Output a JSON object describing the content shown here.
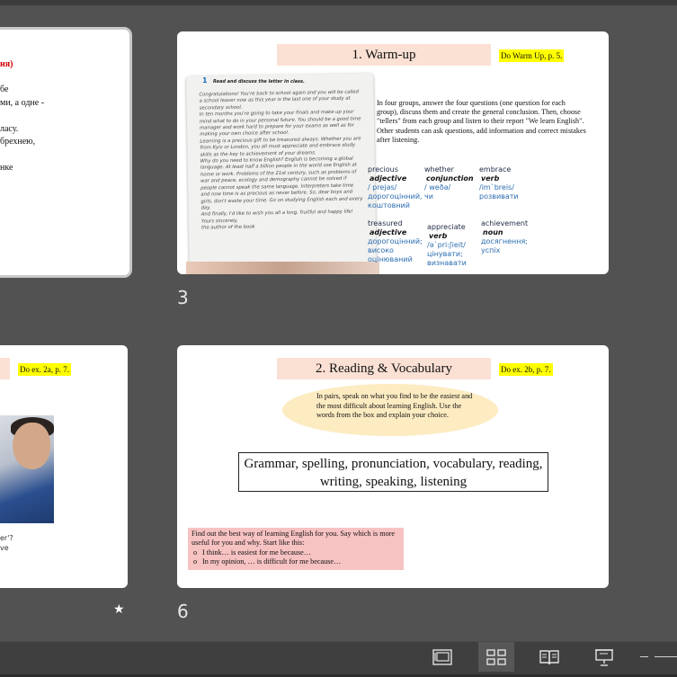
{
  "slides": [
    {
      "number": "",
      "red_heading": "ня)",
      "lines": [
        "бе",
        "ми, а одне -",
        "",
        "ласу.",
        "брехнею,",
        "",
        "нке"
      ]
    },
    {
      "number": "3",
      "title": "1. Warm-up",
      "note": "Do Warm Up, p. 5.",
      "exercise_num": "1",
      "exercise_head": "Read and discuss the letter in class.",
      "letter_text": "Congratulations! You're back to school again and you will be called a school leaver now as this year is the last one of your study at secondary school.\n   In ten months you're going to take your finals and make up your mind what to do in your personal future. You should be a good time manager and work hard to prepare for your exams as well as for making your own choice after school.\n   Learning is a precious gift to be treasured always. Whether you are from Kyiv or London, you all must appreciate and embrace study skills as the key to achievement of your dreams.\n   Why do you need to know English? English is becoming a global language. At least half a billion people in the world use English at home or work. Problems of the 21st century, such as problems of war and peace, ecology and demography cannot be solved if people cannot speak the same language. Interpreters take time and now time is as precious as never before. So, dear boys and girls, don't waste your time. Go on studying English each and every day.\n   And finally, I'd like to wish you all a long, fruitful and happy life!\n   Yours sincerely,\n   the author of the book",
      "instructions": "In four groups, answer the four questions (one question for each group), discuss them and create the general conclusion. Then, choose \"tellers\" from each group and listen to their report \"We learn English\".\nOther students can ask questions, add information and correct mistakes after listening.",
      "vocab": [
        {
          "word": "precious",
          "pos": "adjective",
          "trans": "/ prejəs/\nдорогоцінний,\nкоштовний"
        },
        {
          "word": "whether",
          "pos": "conjunction",
          "trans": "/ weðə/\nчи"
        },
        {
          "word": "embrace",
          "pos": "verb",
          "trans": "/im`breis/\nрозвивати"
        },
        {
          "word": "treasured",
          "pos": "adjective",
          "trans": "дорогоцінний;\nвисоко\nоцінюваний"
        },
        {
          "word": "appreciate",
          "pos": "verb",
          "trans": "/ə`pri:ʃieit/\nцінувати;\nвизнавати"
        },
        {
          "word": "achievement",
          "pos": "noun",
          "trans": "досягнення;\nуспіх"
        }
      ]
    },
    {
      "number": "",
      "note": "Do ex. 2a, p. 7.",
      "small_lines": [
        "er'?",
        "ve"
      ]
    },
    {
      "number": "6",
      "title": "2. Reading & Vocabulary",
      "note": "Do ex. 2b, p. 7.",
      "oval_text": "In pairs, speak on what you find to be the easiest and the most difficult about learning English. Use the words from the box and explain your choice.",
      "words_box": "Grammar, spelling, pronunciation, vocabulary, reading, writing, speaking, listening",
      "find_text": "Find out the best way of learning English for you. Say which is more useful for you and why. Start like this:",
      "bullets": [
        "I think… is easiest for me because…",
        "In my opinion, … is difficult for me because…"
      ]
    }
  ],
  "status_bar": {
    "views": [
      {
        "name": "normal-view-icon",
        "active": false
      },
      {
        "name": "slide-sorter-icon",
        "active": true
      },
      {
        "name": "reading-view-icon",
        "active": false
      },
      {
        "name": "slide-show-icon",
        "active": false
      }
    ]
  }
}
